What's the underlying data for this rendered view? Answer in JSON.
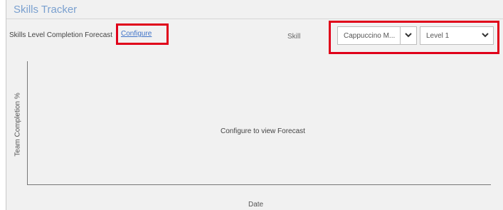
{
  "tracker": {
    "title": "Skills Tracker"
  },
  "forecast": {
    "label": "Skills Level Completion Forecast",
    "configure_link": "Configure"
  },
  "filters": {
    "skill_label": "Skill",
    "skill_select": {
      "selected": "Cappuccino M...",
      "icon": "chevron-down-icon"
    },
    "level_select": {
      "selected": "Level 1",
      "icon": "chevron-down-icon"
    }
  },
  "chart": {
    "ylabel": "Team Completion %",
    "xlabel": "Date",
    "empty_message": "Configure to view Forecast"
  },
  "colors": {
    "highlight": "#e0001a",
    "link": "#3f73c8",
    "title": "#7aa0cf"
  }
}
